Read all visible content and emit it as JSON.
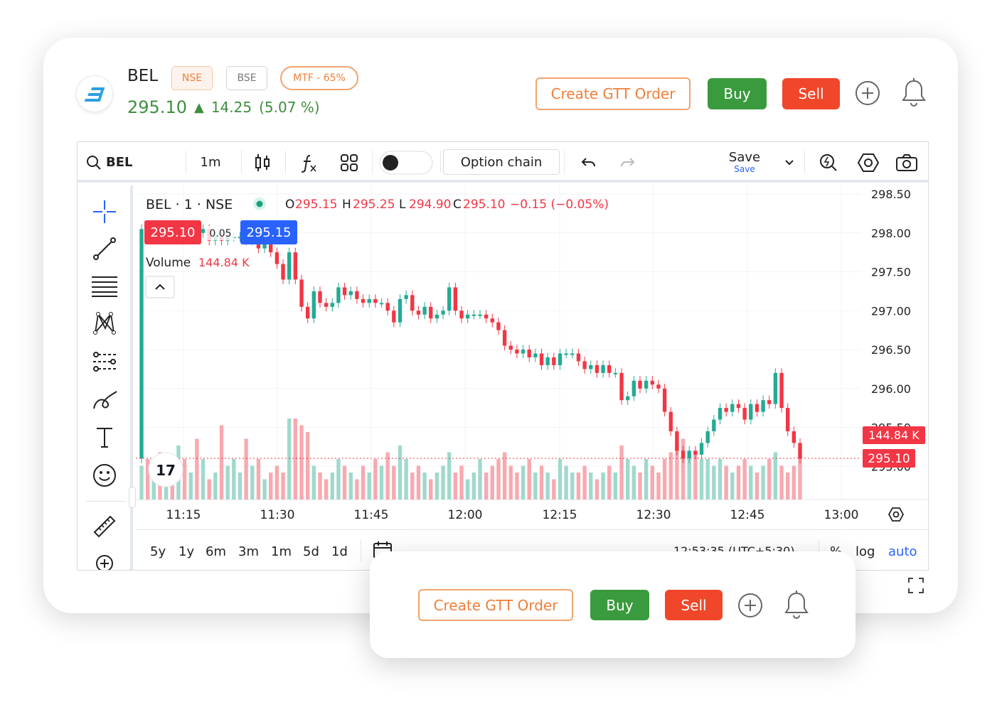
{
  "header": {
    "symbol": "BEL",
    "exchanges": [
      "NSE",
      "BSE"
    ],
    "mtf_badge": "MTF - 65%",
    "ltp": "295.10",
    "change": "14.25",
    "change_pct": "(5.07 %)",
    "colors": {
      "up": "#3f8f3f",
      "gtt": "#ef7f3a",
      "buy": "#3a9b3e",
      "sell": "#f0472a"
    },
    "actions": {
      "gtt_label": "Create GTT Order",
      "buy_label": "Buy",
      "sell_label": "Sell"
    }
  },
  "toolbar": {
    "search_value": "BEL",
    "interval": "1m",
    "option_chain_label": "Option chain",
    "save_label": "Save",
    "save_sub": "Save"
  },
  "legend": {
    "title": "BEL · 1 · NSE",
    "o_label": "O",
    "o": "295.15",
    "h_label": "H",
    "h": "295.25",
    "l_label": "L",
    "l": "294.90",
    "c_label": "C",
    "c": "295.10",
    "chg": "−0.15 (−0.05%)",
    "bid": "295.10",
    "spread": "0.05",
    "ask": "295.15",
    "volume_label": "Volume",
    "volume_value": "144.84 K"
  },
  "chart_data": {
    "type": "candlestick",
    "price_ticks": [
      "298.50",
      "298.00",
      "297.50",
      "297.00",
      "296.50",
      "296.00",
      "295.50",
      "295.00"
    ],
    "time_ticks": [
      "11:15",
      "11:30",
      "11:45",
      "12:00",
      "12:15",
      "12:30",
      "12:45",
      "13:00"
    ],
    "last_price_tag": "295.10",
    "last_volume_tag": "144.84 K",
    "ylim": [
      294.9,
      298.6
    ],
    "bars": [
      [
        295.1,
        298.05
      ],
      [
        298.05,
        298.0
      ],
      [
        298.0,
        298.05
      ],
      [
        298.05,
        297.95
      ],
      [
        297.95,
        298.0
      ],
      [
        298.0,
        297.95
      ],
      [
        297.95,
        298.05
      ],
      [
        298.05,
        297.95
      ],
      [
        297.95,
        298.1
      ],
      [
        298.1,
        298.0
      ],
      [
        298.0,
        298.05
      ],
      [
        298.05,
        297.9
      ],
      [
        297.9,
        297.95
      ],
      [
        297.95,
        297.9
      ],
      [
        297.9,
        297.95
      ],
      [
        297.95,
        297.95
      ],
      [
        297.95,
        297.95
      ],
      [
        297.95,
        297.9
      ],
      [
        297.9,
        298.0
      ],
      [
        298.0,
        297.8
      ],
      [
        297.8,
        297.9
      ],
      [
        297.9,
        297.75
      ],
      [
        297.75,
        297.6
      ],
      [
        297.6,
        297.4
      ],
      [
        297.4,
        297.75
      ],
      [
        297.75,
        297.4
      ],
      [
        297.4,
        297.05
      ],
      [
        297.05,
        296.9
      ],
      [
        296.9,
        297.25
      ],
      [
        297.25,
        297.1
      ],
      [
        297.1,
        297.05
      ],
      [
        297.05,
        297.1
      ],
      [
        297.1,
        297.3
      ],
      [
        297.3,
        297.2
      ],
      [
        297.2,
        297.25
      ],
      [
        297.25,
        297.15
      ],
      [
        297.15,
        297.1
      ],
      [
        297.1,
        297.15
      ],
      [
        297.15,
        297.1
      ],
      [
        297.1,
        297.1
      ],
      [
        297.1,
        297.0
      ],
      [
        297.0,
        296.85
      ],
      [
        296.85,
        297.15
      ],
      [
        297.15,
        297.2
      ],
      [
        297.2,
        297.0
      ],
      [
        297.0,
        296.95
      ],
      [
        296.95,
        297.05
      ],
      [
        297.05,
        296.9
      ],
      [
        296.9,
        296.95
      ],
      [
        296.95,
        297.0
      ],
      [
        297.0,
        297.3
      ],
      [
        297.3,
        297.0
      ],
      [
        297.0,
        296.9
      ],
      [
        296.9,
        296.95
      ],
      [
        296.95,
        296.95
      ],
      [
        296.95,
        296.95
      ],
      [
        296.95,
        296.9
      ],
      [
        296.9,
        296.85
      ],
      [
        296.85,
        296.75
      ],
      [
        296.75,
        296.55
      ],
      [
        296.55,
        296.5
      ],
      [
        296.5,
        296.45
      ],
      [
        296.45,
        296.5
      ],
      [
        296.5,
        296.4
      ],
      [
        296.4,
        296.45
      ],
      [
        296.45,
        296.3
      ],
      [
        296.3,
        296.4
      ],
      [
        296.4,
        296.3
      ],
      [
        296.3,
        296.45
      ],
      [
        296.45,
        296.45
      ],
      [
        296.45,
        296.45
      ],
      [
        296.45,
        296.35
      ],
      [
        296.35,
        296.25
      ],
      [
        296.25,
        296.3
      ],
      [
        296.3,
        296.2
      ],
      [
        296.2,
        296.3
      ],
      [
        296.3,
        296.2
      ],
      [
        296.2,
        296.2
      ],
      [
        296.2,
        295.85
      ],
      [
        295.85,
        295.9
      ],
      [
        295.9,
        296.1
      ],
      [
        296.1,
        296.0
      ],
      [
        296.0,
        296.1
      ],
      [
        296.1,
        296.05
      ],
      [
        296.05,
        296.0
      ],
      [
        296.0,
        295.7
      ],
      [
        295.7,
        295.45
      ],
      [
        295.45,
        295.2
      ],
      [
        295.2,
        295.1
      ],
      [
        295.1,
        295.2
      ],
      [
        295.2,
        295.15
      ],
      [
        295.15,
        295.3
      ],
      [
        295.3,
        295.45
      ],
      [
        295.45,
        295.6
      ],
      [
        295.6,
        295.75
      ],
      [
        295.75,
        295.7
      ],
      [
        295.7,
        295.8
      ],
      [
        295.8,
        295.75
      ],
      [
        295.75,
        295.6
      ],
      [
        295.6,
        295.8
      ],
      [
        295.8,
        295.7
      ],
      [
        295.7,
        295.85
      ],
      [
        295.85,
        295.8
      ],
      [
        295.8,
        296.2
      ],
      [
        296.2,
        295.75
      ],
      [
        295.75,
        295.45
      ],
      [
        295.45,
        295.3
      ],
      [
        295.3,
        295.1
      ]
    ],
    "volumes": [
      0.25,
      0.3,
      0.2,
      0.35,
      0.15,
      0.25,
      0.4,
      0.3,
      0.2,
      0.45,
      0.3,
      0.15,
      0.2,
      0.55,
      0.25,
      0.3,
      0.2,
      0.45,
      0.25,
      0.3,
      0.15,
      0.2,
      0.25,
      0.2,
      0.6,
      0.6,
      0.55,
      0.5,
      0.25,
      0.2,
      0.15,
      0.2,
      0.3,
      0.25,
      0.2,
      0.15,
      0.25,
      0.2,
      0.3,
      0.25,
      0.35,
      0.25,
      0.4,
      0.3,
      0.2,
      0.25,
      0.2,
      0.15,
      0.2,
      0.25,
      0.35,
      0.2,
      0.25,
      0.15,
      0.2,
      0.3,
      0.2,
      0.25,
      0.3,
      0.35,
      0.25,
      0.2,
      0.25,
      0.3,
      0.2,
      0.25,
      0.2,
      0.15,
      0.3,
      0.25,
      0.2,
      0.2,
      0.25,
      0.2,
      0.15,
      0.2,
      0.25,
      0.2,
      0.4,
      0.3,
      0.25,
      0.2,
      0.3,
      0.25,
      0.2,
      0.3,
      0.35,
      0.4,
      0.45,
      0.3,
      0.35,
      0.3,
      0.3,
      0.25,
      0.3,
      0.25,
      0.2,
      0.25,
      0.3,
      0.25,
      0.2,
      0.25,
      0.3,
      0.35,
      0.25,
      0.2,
      0.25,
      0.35
    ]
  },
  "timeframes": [
    "5y",
    "1y",
    "6m",
    "3m",
    "1m",
    "5d",
    "1d"
  ],
  "status": {
    "clock": "12:53:35 (UTC+5:30)",
    "pct": "%",
    "log": "log",
    "auto": "auto"
  }
}
